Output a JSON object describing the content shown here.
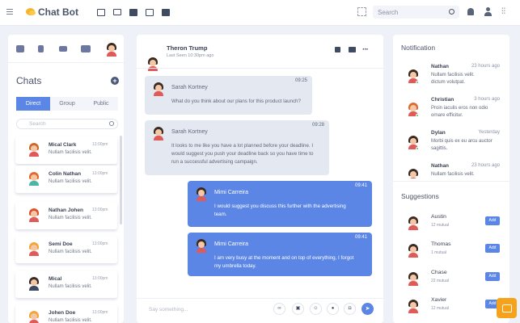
{
  "app": {
    "title": "Chat Bot",
    "search_placeholder": "Search"
  },
  "left": {
    "title": "Chats",
    "tabs": [
      "Direct",
      "Group",
      "Public"
    ],
    "search_placeholder": "Search",
    "chats": [
      {
        "name": "Mical Clark",
        "msg": "Nullam facilisis velit.",
        "time": "13:00pm",
        "hair": "#c96a2b",
        "shirt": "#e05a5a"
      },
      {
        "name": "Colin Nathan",
        "msg": "Nullam facilisis velit.",
        "time": "13:00pm",
        "hair": "#e06a2c",
        "shirt": "#4bb6a3"
      },
      {
        "name": "Nathan Johen",
        "msg": "Nullam facilisis velit.",
        "time": "13:00pm",
        "hair": "#d9532c",
        "shirt": "#e05a5a"
      },
      {
        "name": "Semi Doe",
        "msg": "Nullam facilisis velit.",
        "time": "13:00pm",
        "hair": "#f0a63a",
        "shirt": "#e05a5a"
      },
      {
        "name": "Mical",
        "msg": "Nullam facilisis velit.",
        "time": "13:00pm",
        "hair": "#3a2a22",
        "shirt": "#3e4a63"
      },
      {
        "name": "Johen Doe",
        "msg": "Nullam facilisis velit.",
        "time": "13:00pm",
        "hair": "#f0a63a",
        "shirt": "#e05a5a"
      }
    ]
  },
  "conversation": {
    "name": "Theron Trump",
    "status": "Last Seen 10:30pm ago",
    "messages": [
      {
        "dir": "in",
        "name": "Sarah Kortney",
        "time": "09:25",
        "lines": [
          "What do you think about our plans for this product launch?"
        ]
      },
      {
        "dir": "in",
        "name": "Sarah Kortney",
        "time": "09:28",
        "lines": [
          "It looks to me like you have a lot planned before your deadline. I",
          "would suggest you push your deadline back so you have time to",
          "run a successful advertising campaign."
        ]
      },
      {
        "dir": "out",
        "name": "Mimi Carreira",
        "time": "09:41",
        "lines": [
          "I would suggest you discuss this further with the advertising",
          "team."
        ]
      },
      {
        "dir": "out",
        "name": "Mimi Carreira",
        "time": "09:41",
        "lines": [
          "I am very busy at the moment and on top of everything, I forgot",
          "my umbrella today."
        ]
      }
    ],
    "input_placeholder": "Say something..."
  },
  "notifications": {
    "title": "Notification",
    "items": [
      {
        "name": "Nathan",
        "time": "23 hours ago",
        "text": [
          "Nullam facilisis velit.",
          "dictum volutpat."
        ]
      },
      {
        "name": "Christian",
        "time": "3 hours ago",
        "text": [
          "Proin iaculis eros non odio",
          "ornare efficitur."
        ]
      },
      {
        "name": "Dylan",
        "time": "Yesterday",
        "text": [
          "Morbi quis ex eu arcu auctor",
          "sagittis."
        ]
      },
      {
        "name": "Nathan",
        "time": "23 hours ago",
        "text": [
          "Nullam facilisis velit."
        ]
      }
    ]
  },
  "suggestions": {
    "title": "Suggestions",
    "add_label": "Add",
    "items": [
      {
        "name": "Austin",
        "mutual": "12 mutual"
      },
      {
        "name": "Thomas",
        "mutual": "1 mutual"
      },
      {
        "name": "Chase",
        "mutual": "22 mutual"
      },
      {
        "name": "Xavier",
        "mutual": "12 mutual"
      }
    ]
  },
  "colors": {
    "accent": "#5b86e5",
    "brand": "#f7b52c",
    "fab": "#f7a21b",
    "online": "#3fc96b"
  }
}
